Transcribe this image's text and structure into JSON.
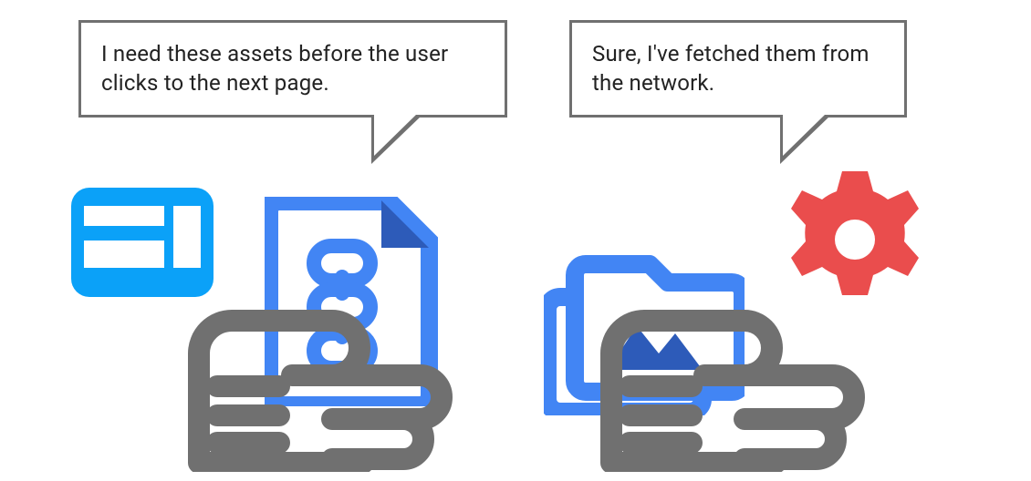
{
  "speech": {
    "left": "I need these assets before the user clicks to the next page.",
    "right": "Sure, I've fetched them from the network."
  },
  "colors": {
    "brightBlue": "#0BA1F8",
    "midBlue": "#4285F4",
    "darkBlue": "#2D5BB9",
    "gray": "#707070",
    "red": "#EA4D4D",
    "white": "#FFFFFF"
  },
  "icons": {
    "webpage": "webpage-icon",
    "documentLinks": "linked-document-icon",
    "handLeft": "hand-icon",
    "imageFolder": "image-folder-icon",
    "handRight": "hand-icon",
    "gear": "gear-icon"
  }
}
